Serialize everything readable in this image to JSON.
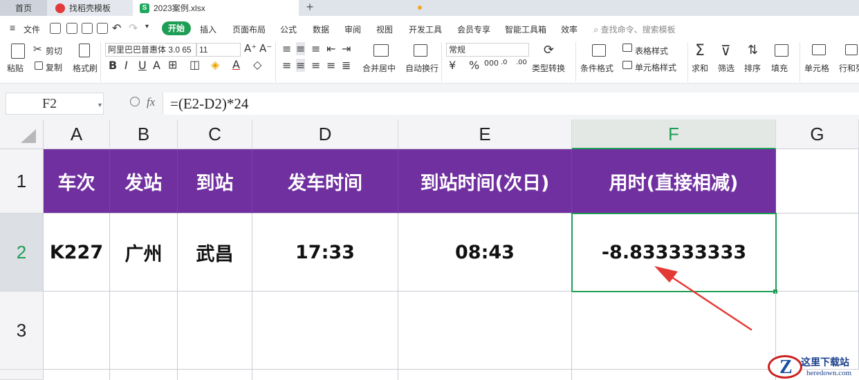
{
  "tabs": {
    "home": "首页",
    "template": "找稻壳模板",
    "file": "2023案例.xlsx",
    "file_icon": "S"
  },
  "menu": {
    "file": "文件",
    "items": [
      "开始",
      "插入",
      "页面布局",
      "公式",
      "数据",
      "审阅",
      "视图",
      "开发工具",
      "会员专享",
      "智能工具箱",
      "效率"
    ],
    "search_placeholder": "查找命令、搜索模板"
  },
  "ribbon": {
    "paste": "粘贴",
    "cut": "剪切",
    "copy": "复制",
    "format_painter": "格式刷",
    "font_name": "阿里巴巴普惠体 3.0 65",
    "font_size": "11",
    "merge_center": "合并居中",
    "wrap_text": "自动换行",
    "number_format": "常规",
    "type_convert": "类型转换",
    "conditional_format": "条件格式",
    "table_style": "表格样式",
    "cell_style": "单元格样式",
    "sum": "求和",
    "filter": "筛选",
    "sort": "排序",
    "fill": "填充",
    "cell": "单元格",
    "row_col": "行和列"
  },
  "formula_bar": {
    "name_box": "F2",
    "fx": "fx",
    "formula": "=(E2-D2)*24"
  },
  "sheet": {
    "columns": [
      "A",
      "B",
      "C",
      "D",
      "E",
      "F",
      "G"
    ],
    "rows": [
      "1",
      "2",
      "3"
    ],
    "header_row": [
      "车次",
      "发站",
      "到站",
      "发车时间",
      "到站时间(次日)",
      "用时(直接相减)"
    ],
    "data_row": [
      "K227",
      "广州",
      "武昌",
      "17:33",
      "08:43",
      "-8.833333333"
    ],
    "selected_cell": "F2",
    "header_fill": "#7030a0",
    "accent": "#1e9e55",
    "arrow_color": "#e53935"
  },
  "watermark": {
    "title": "这里下载站",
    "url": "heredown.com"
  }
}
